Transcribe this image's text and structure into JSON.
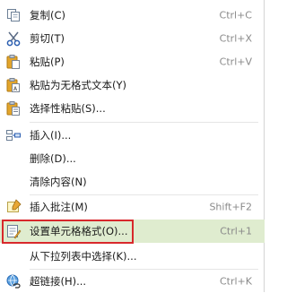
{
  "menu": {
    "items": [
      {
        "label": "复制(C)",
        "shortcut": "Ctrl+C",
        "icon": "copy-icon"
      },
      {
        "label": "剪切(T)",
        "shortcut": "Ctrl+X",
        "icon": "scissors-icon"
      },
      {
        "label": "粘贴(P)",
        "shortcut": "Ctrl+V",
        "icon": "paste-icon"
      },
      {
        "label": "粘贴为无格式文本(Y)",
        "shortcut": "",
        "icon": "paste-text-icon"
      },
      {
        "label": "选择性粘贴(S)...",
        "shortcut": "",
        "icon": "paste-special-icon"
      },
      {
        "label": "插入(I)...",
        "shortcut": "",
        "icon": "insert-icon"
      },
      {
        "label": "删除(D)...",
        "shortcut": "",
        "icon": ""
      },
      {
        "label": "清除内容(N)",
        "shortcut": "",
        "icon": ""
      },
      {
        "label": "插入批注(M)",
        "shortcut": "Shift+F2",
        "icon": "comment-icon"
      },
      {
        "label": "设置单元格格式(O)...",
        "shortcut": "Ctrl+1",
        "icon": "format-cells-icon"
      },
      {
        "label": "从下拉列表中选择(K)...",
        "shortcut": "",
        "icon": ""
      },
      {
        "label": "超链接(H)...",
        "shortcut": "Ctrl+K",
        "icon": "hyperlink-icon"
      }
    ],
    "highlight_color": "#dfeccf",
    "annotation_color": "#d8282c"
  }
}
